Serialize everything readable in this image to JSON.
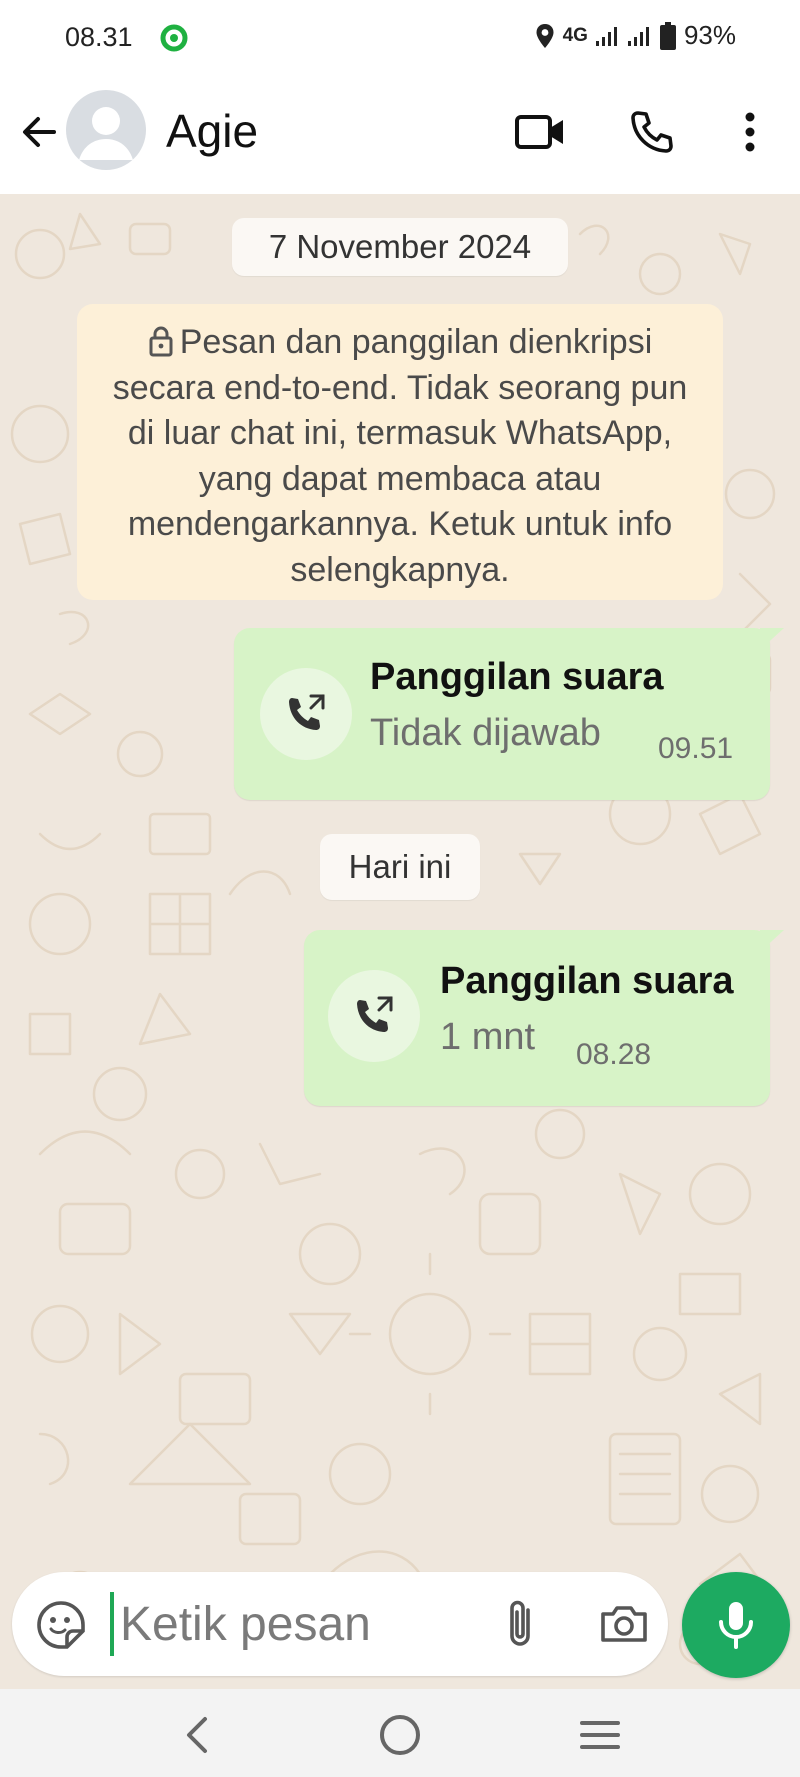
{
  "status_bar": {
    "time": "08.31",
    "network": "4G",
    "battery": "93%",
    "icons": [
      "app-notification-icon",
      "location-icon",
      "signal-icon",
      "signal-icon",
      "battery-icon"
    ]
  },
  "header": {
    "contact_name": "Agie",
    "icons": [
      "back-arrow-icon",
      "avatar-placeholder",
      "video-call-icon",
      "voice-call-icon",
      "more-vert-icon"
    ]
  },
  "chat": {
    "date_1": "7 November 2024",
    "encryption_note": "Pesan dan panggilan dienkripsi secara end-to-end. Tidak seorang pun di luar chat ini, termasuk WhatsApp, yang dapat membaca atau mendengarkannya. Ketuk untuk info selengkapnya.",
    "date_2": "Hari ini",
    "messages": [
      {
        "title": "Panggilan suara",
        "subtitle": "Tidak dijawab",
        "time": "09.51"
      },
      {
        "title": "Panggilan suara",
        "subtitle": "1 mnt",
        "time": "08.28"
      }
    ]
  },
  "input": {
    "placeholder": "Ketik pesan",
    "icons": [
      "sticker-icon",
      "attach-icon",
      "camera-icon",
      "mic-icon"
    ]
  },
  "colors": {
    "bubble": "#d7f3c7",
    "encryption_bg": "#fdf0d8",
    "chat_bg": "#efe7dd",
    "accent": "#1daa61"
  }
}
